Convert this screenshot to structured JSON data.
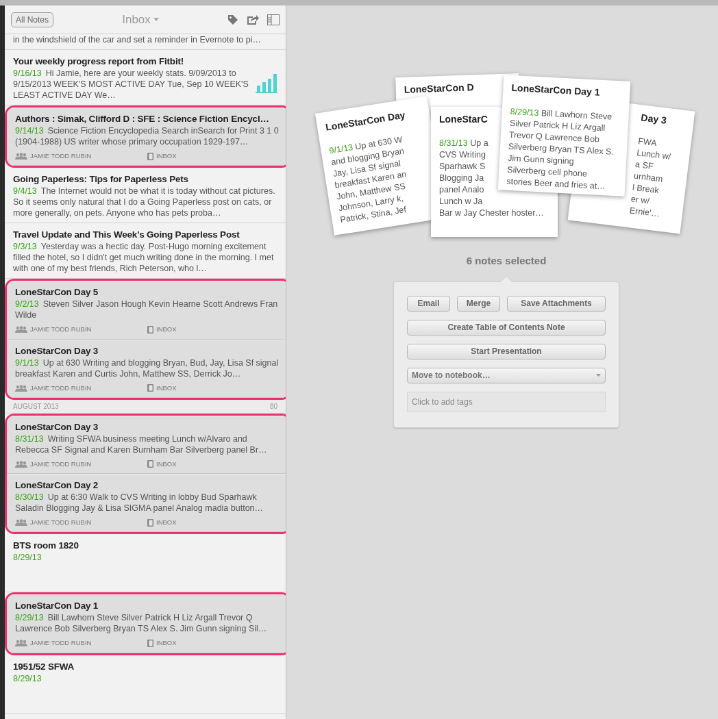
{
  "list_header": {
    "all_notes_button": "All Notes",
    "title": "Inbox"
  },
  "items": [
    {
      "kind": "note",
      "snippet": "in the windshield of the car and set a reminder in Evernote to pi…",
      "selected": false
    },
    {
      "kind": "note",
      "title": "Your weekly progress report from Fitbit!",
      "date": "9/16/13",
      "snippet": "Hi Jamie, here are your weekly stats. 9/09/2013 to 9/15/2013 WEEK'S MOST ACTIVE DAY Tue, Sep 10 WEEK'S LEAST ACTIVE DAY We…",
      "has_chart": true,
      "selected": false
    },
    {
      "kind": "note",
      "title": "Authors : Simak, Clifford D : SFE : Science Fiction Encycl…",
      "date": "9/14/13",
      "snippet": "Science Fiction Encyclopedia Search inSearch for Print 3 1 0 (1904-1988) US writer whose primary occupation 1929-197…",
      "author": "JAMIE TODD RUBIN",
      "notebook": "INBOX",
      "selected": true
    },
    {
      "kind": "note",
      "title": "Going Paperless: Tips for Paperless Pets",
      "date": "9/4/13",
      "snippet": "The Internet would not be what it is today without cat pictures. So it seems only natural that I do a Going Paperless post on cats, or more generally, on pets. Anyone who has pets proba…",
      "selected": false
    },
    {
      "kind": "note",
      "title": "Travel Update and This Week's Going Paperless Post",
      "date": "9/3/13",
      "snippet": "Yesterday was a hectic day. Post-Hugo morning excitement filled the hotel, so I didn't get much writing done in the morning. I met with one of my best friends, Rich Peterson, who l…",
      "selected": false
    },
    {
      "kind": "note",
      "title": "LoneStarCon Day 5",
      "date": "9/2/13",
      "snippet": "Steven Silver Jason Hough Kevin Hearne Scott Andrews Fran Wilde",
      "author": "JAMIE TODD RUBIN",
      "notebook": "INBOX",
      "selected": true
    },
    {
      "kind": "note",
      "title": "LoneStarCon Day 3",
      "date": "9/1/13",
      "snippet": "Up at 630 Writing and blogging Bryan, Bud, Jay, Lisa Sf signal breakfast Karen and Curtis John, Matthew SS, Derrick Jo…",
      "author": "JAMIE TODD RUBIN",
      "notebook": "INBOX",
      "selected": true
    },
    {
      "kind": "section",
      "label": "AUGUST 2013",
      "count": "80"
    },
    {
      "kind": "note",
      "title": "LoneStarCon Day 3",
      "date": "8/31/13",
      "snippet": "Writing SFWA business meeting Lunch w/Alvaro and Rebecca SF Signal and Karen Burnham Bar Silverberg panel Br…",
      "author": "JAMIE TODD RUBIN",
      "notebook": "INBOX",
      "selected": true
    },
    {
      "kind": "note",
      "title": "LoneStarCon Day 2",
      "date": "8/30/13",
      "snippet": "Up at 6:30 Walk to CVS Writing in lobby Bud Sparhawk Saladin Blogging Jay & Lisa SIGMA panel Analog madia button…",
      "author": "JAMIE TODD RUBIN",
      "notebook": "INBOX",
      "selected": true
    },
    {
      "kind": "note",
      "title": "BTS room 1820",
      "date": "8/29/13",
      "selected": false
    },
    {
      "kind": "note",
      "title": "LoneStarCon Day 1",
      "date": "8/29/13",
      "snippet": "Bill Lawhorn Steve Silver Patrick H Liz Argall Trevor Q Lawrence Bob Silverberg Bryan TS Alex S. Jim Gunn signing Sil…",
      "author": "JAMIE TODD RUBIN",
      "notebook": "INBOX",
      "selected": true
    },
    {
      "kind": "note",
      "title": "1951/52 SFWA",
      "date": "8/29/13",
      "selected": false
    }
  ],
  "card_stack": [
    {
      "title": "LoneStarCon D"
    },
    {
      "title": "LoneStarCon Day",
      "date": "9/1/13",
      "lines": [
        "Up at 630 W",
        "and blogging Bryan",
        "Jay, Lisa Sf signal",
        "breakfast Karen an",
        "John, Matthew SS",
        "Johnson, Larry k,",
        "Patrick, Stina, Jef"
      ]
    },
    {
      "title": "Day 3",
      "lines": [
        "FWA",
        "Lunch w/",
        "a SF",
        "urnham",
        "l Break",
        "er w/",
        "Ernie'…"
      ]
    },
    {
      "title": "LoneStarC",
      "date": "8/31/13",
      "lines": [
        "Up a",
        "CVS Writing",
        "Sparhawk S",
        "Blogging Ja",
        "panel Analo",
        "Lunch w Ja",
        "Bar w Jay Chester hoster…"
      ]
    },
    {
      "title": "LoneStarCon Day 1",
      "date": "8/29/13",
      "lines": [
        "Bill Lawhorn Steve",
        "Silver Patrick H Liz Argall",
        "Trevor Q Lawrence Bob",
        "Silverberg Bryan TS Alex S.",
        "Jim Gunn signing",
        "Silverberg cell phone",
        "stories Beer and fries at…"
      ]
    }
  ],
  "selection": {
    "count_label": "6 notes selected",
    "buttons": [
      "Email",
      "Merge",
      "Save Attachments"
    ],
    "wide_buttons": [
      "Create Table of Contents Note",
      "Start Presentation"
    ],
    "notebook_select": "Move to notebook…",
    "tags_placeholder": "Click to add tags"
  }
}
